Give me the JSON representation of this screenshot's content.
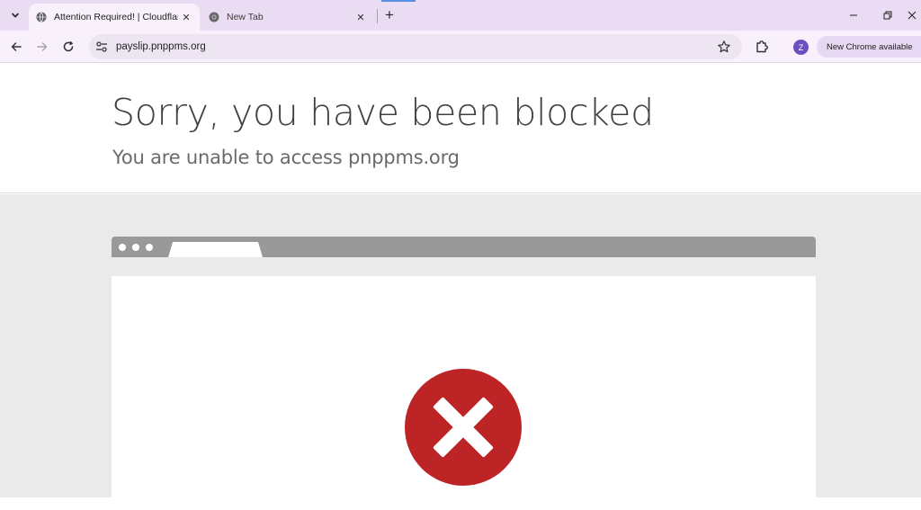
{
  "browser": {
    "tabs": [
      {
        "title": "Attention Required! | Cloudflare",
        "active": true,
        "icon": "globe-icon"
      },
      {
        "title": "New Tab",
        "active": false,
        "icon": "chrome-icon"
      }
    ],
    "new_tab_symbol": "+",
    "address": "payslip.pnppms.org",
    "profile_initial": "Z",
    "update_chip": "New Chrome available",
    "accent_color": "#e9dcf3"
  },
  "page": {
    "heading": "Sorry, you have been blocked",
    "subheading": "You are unable to access pnppms.org",
    "error_icon": "x-circle-icon",
    "error_color": "#bd2426"
  }
}
